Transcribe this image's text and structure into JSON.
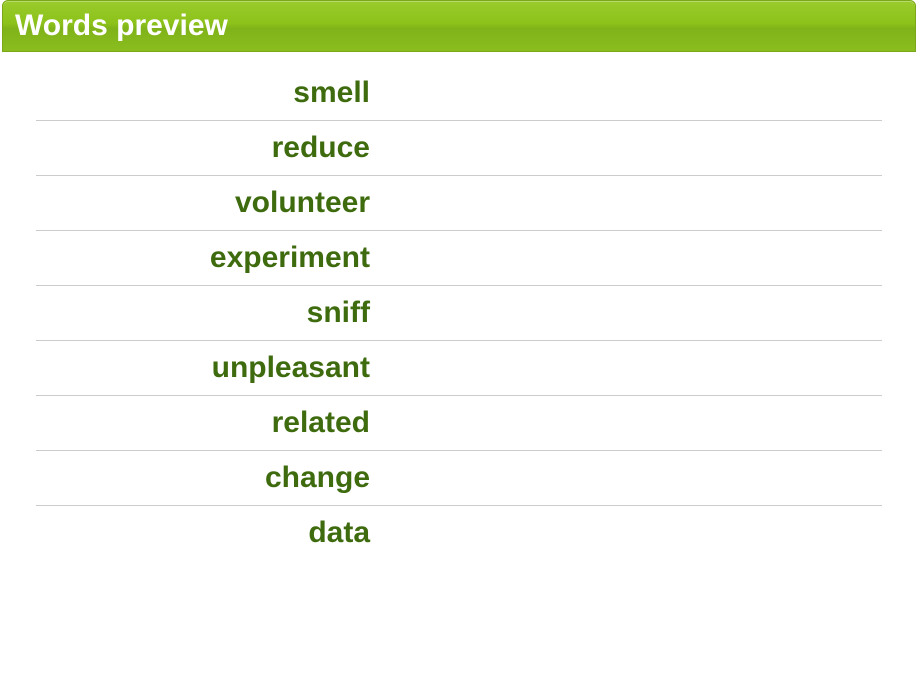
{
  "header": {
    "title": "Words preview"
  },
  "words": [
    {
      "term": "smell"
    },
    {
      "term": "reduce"
    },
    {
      "term": "volunteer"
    },
    {
      "term": "experiment"
    },
    {
      "term": "sniff"
    },
    {
      "term": "unpleasant"
    },
    {
      "term": "related"
    },
    {
      "term": "change"
    },
    {
      "term": "data"
    }
  ]
}
